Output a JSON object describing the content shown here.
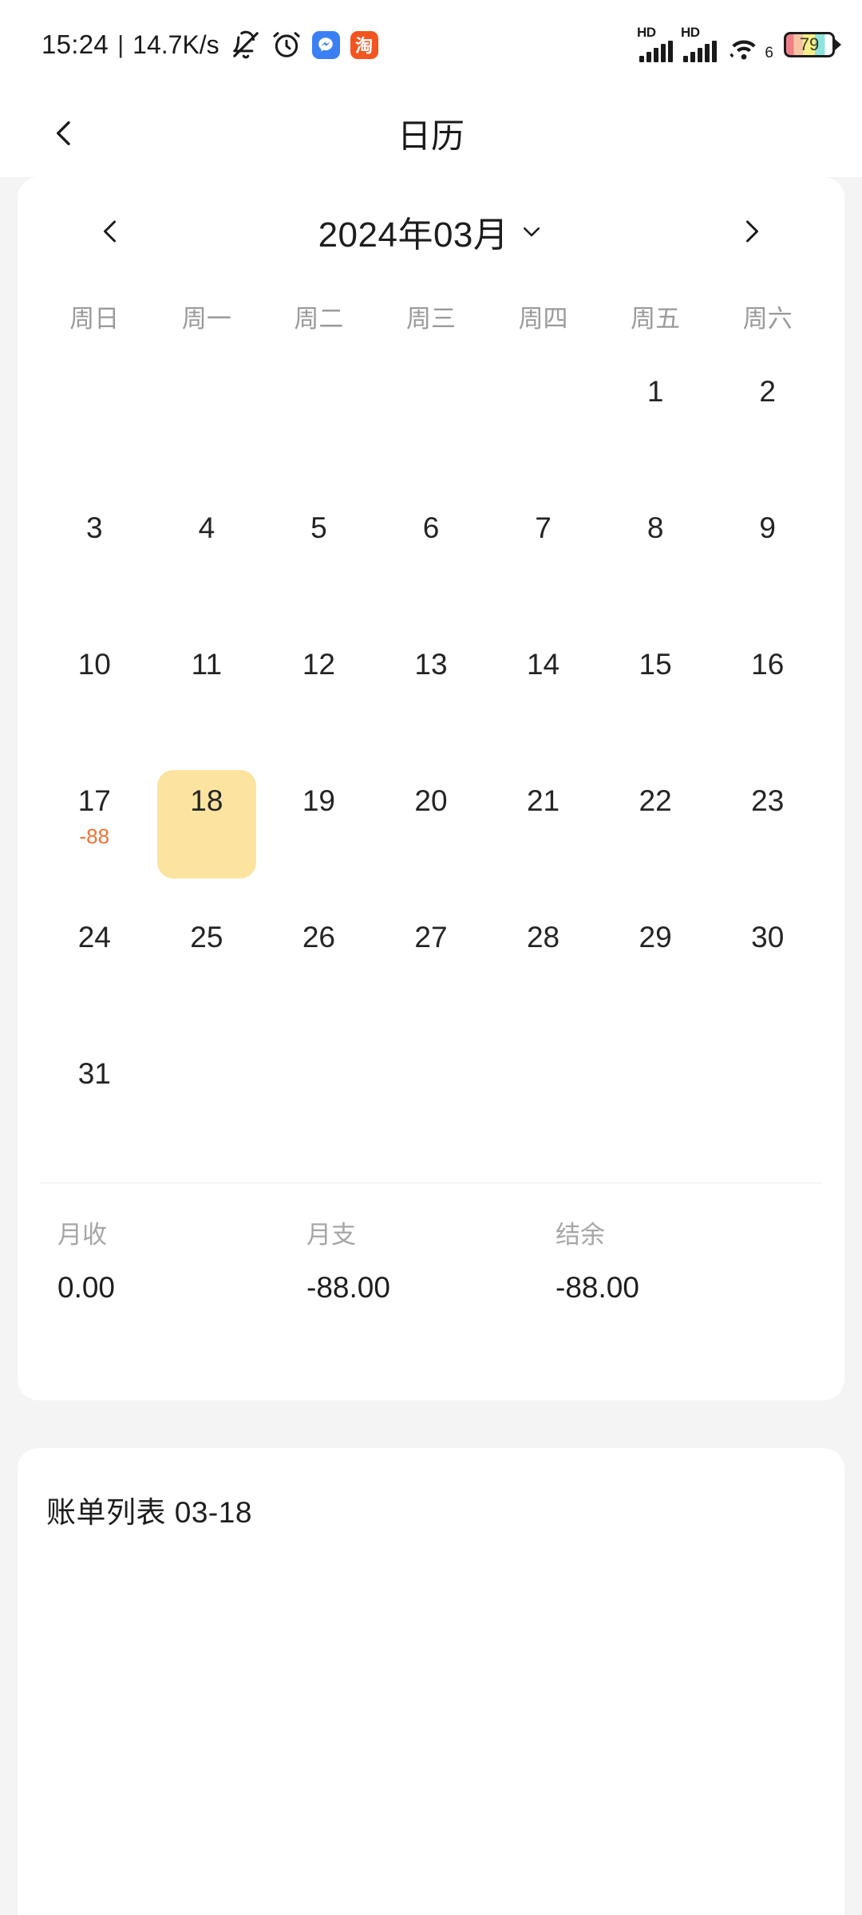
{
  "status_bar": {
    "time": "15:24",
    "separator": "|",
    "net_speed": "14.7K/s",
    "icons": [
      "bell-muted-icon",
      "alarm-clock-icon"
    ],
    "app_badges": [
      {
        "name": "messenger-app-icon",
        "glyph": "",
        "color": "#3b7ff5"
      },
      {
        "name": "taobao-app-icon",
        "glyph": "淘",
        "color": "#f4541f"
      }
    ],
    "signal_1": {
      "label": "HD",
      "bars": 5
    },
    "signal_2": {
      "label": "HD",
      "bars": 5
    },
    "wifi": {
      "generation": "6"
    },
    "battery": {
      "level": "79"
    }
  },
  "header": {
    "back_icon": "chevron-left-icon",
    "title": "日历"
  },
  "calendar": {
    "prev_label": "‹",
    "next_label": "›",
    "month_title": "2024年03月",
    "dropdown_icon": "chevron-down-icon",
    "weekdays": [
      "周日",
      "周一",
      "周二",
      "周三",
      "周四",
      "周五",
      "周六"
    ],
    "leading_blanks": 5,
    "days": [
      {
        "day": "1"
      },
      {
        "day": "2"
      },
      {
        "day": "3"
      },
      {
        "day": "4"
      },
      {
        "day": "5"
      },
      {
        "day": "6"
      },
      {
        "day": "7"
      },
      {
        "day": "8"
      },
      {
        "day": "9"
      },
      {
        "day": "10"
      },
      {
        "day": "11"
      },
      {
        "day": "12"
      },
      {
        "day": "13"
      },
      {
        "day": "14"
      },
      {
        "day": "15"
      },
      {
        "day": "16"
      },
      {
        "day": "17",
        "amount": "-88"
      },
      {
        "day": "18",
        "selected": true
      },
      {
        "day": "19"
      },
      {
        "day": "20"
      },
      {
        "day": "21"
      },
      {
        "day": "22"
      },
      {
        "day": "23"
      },
      {
        "day": "24"
      },
      {
        "day": "25"
      },
      {
        "day": "26"
      },
      {
        "day": "27"
      },
      {
        "day": "28"
      },
      {
        "day": "29"
      },
      {
        "day": "30"
      },
      {
        "day": "31"
      }
    ],
    "selected_highlight_color": "#fce4a0",
    "amount_color": "#ef7134"
  },
  "summary": {
    "columns": [
      {
        "label": "月收",
        "value": "0.00"
      },
      {
        "label": "月支",
        "value": "-88.00"
      },
      {
        "label": "结余",
        "value": "-88.00"
      }
    ]
  },
  "bills": {
    "title": "账单列表 03-18"
  }
}
